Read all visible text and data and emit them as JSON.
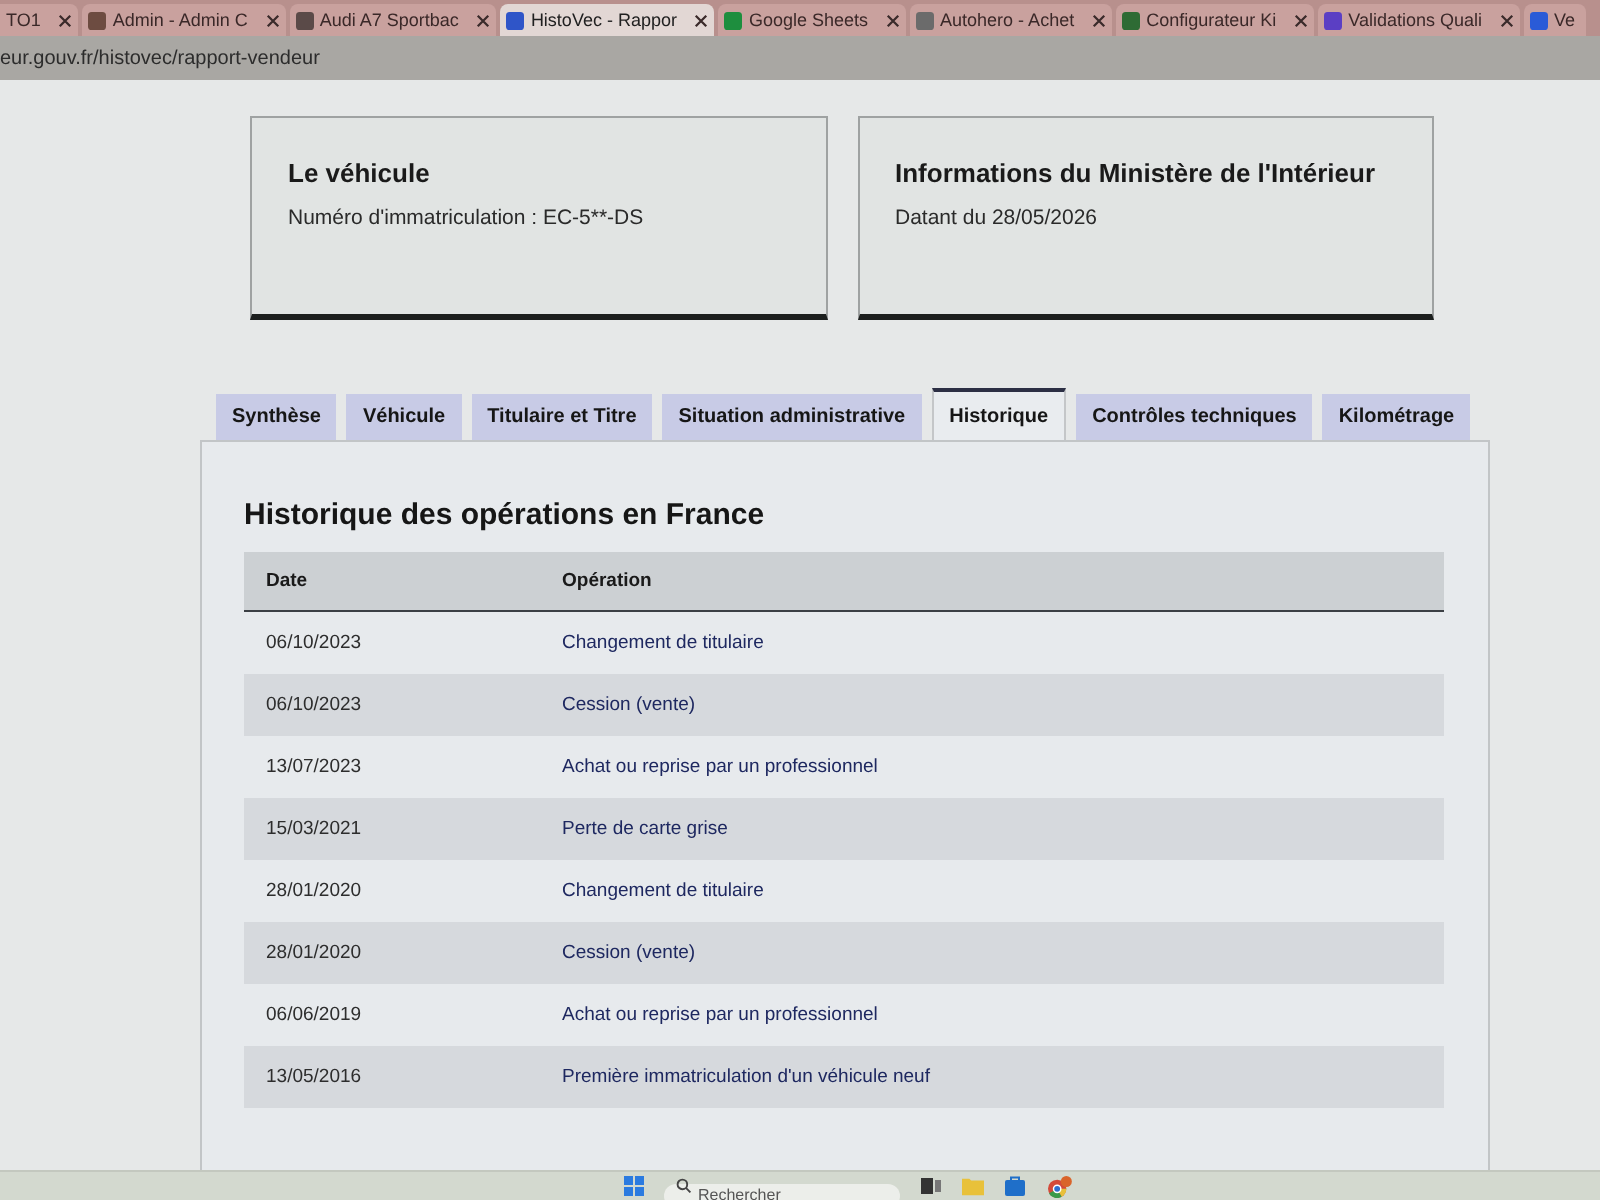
{
  "browser": {
    "tabs": [
      {
        "title": "TO1",
        "selected": false
      },
      {
        "title": "Admin - Admin C",
        "selected": false,
        "color": "#6d4c41"
      },
      {
        "title": "Audi A7 Sportbac",
        "selected": false,
        "color": "#5a4a48"
      },
      {
        "title": "HistoVec - Rappor",
        "selected": true,
        "color": "#2f55c8"
      },
      {
        "title": "Google Sheets",
        "selected": false,
        "color": "#1e8e3e"
      },
      {
        "title": "Autohero - Achet",
        "selected": false,
        "color": "#6b6b6b"
      },
      {
        "title": "Configurateur Ki",
        "selected": false,
        "color": "#2e6b34"
      },
      {
        "title": "Validations Quali",
        "selected": false,
        "color": "#5b3fc4"
      },
      {
        "title": "Ve",
        "selected": false,
        "color": "#2a5bd7"
      }
    ],
    "address": "eur.gouv.fr/histovec/rapport-vendeur"
  },
  "cards": [
    {
      "title": "Le véhicule",
      "text": "Numéro d'immatriculation : EC-5**-DS"
    },
    {
      "title": "Informations du Ministère de l'Intérieur",
      "text": "Datant du 28/05/2026"
    }
  ],
  "tabs": [
    {
      "label": "Synthèse",
      "selected": false
    },
    {
      "label": "Véhicule",
      "selected": false
    },
    {
      "label": "Titulaire et Titre",
      "selected": false
    },
    {
      "label": "Situation administrative",
      "selected": false
    },
    {
      "label": "Historique",
      "selected": true
    },
    {
      "label": "Contrôles techniques",
      "selected": false
    },
    {
      "label": "Kilométrage",
      "selected": false
    }
  ],
  "history": {
    "title": "Historique des opérations en France",
    "columns": [
      "Date",
      "Opération"
    ],
    "rows": [
      {
        "date": "06/10/2023",
        "operation": "Changement de titulaire"
      },
      {
        "date": "06/10/2023",
        "operation": "Cession (vente)"
      },
      {
        "date": "13/07/2023",
        "operation": "Achat ou reprise par un professionnel"
      },
      {
        "date": "15/03/2021",
        "operation": "Perte de carte grise"
      },
      {
        "date": "28/01/2020",
        "operation": "Changement de titulaire"
      },
      {
        "date": "28/01/2020",
        "operation": "Cession (vente)"
      },
      {
        "date": "06/06/2019",
        "operation": "Achat ou reprise par un professionnel"
      },
      {
        "date": "13/05/2016",
        "operation": "Première immatriculation d'un véhicule neuf"
      }
    ]
  },
  "taskbar": {
    "search": {
      "placeholder": "Rechercher"
    }
  }
}
